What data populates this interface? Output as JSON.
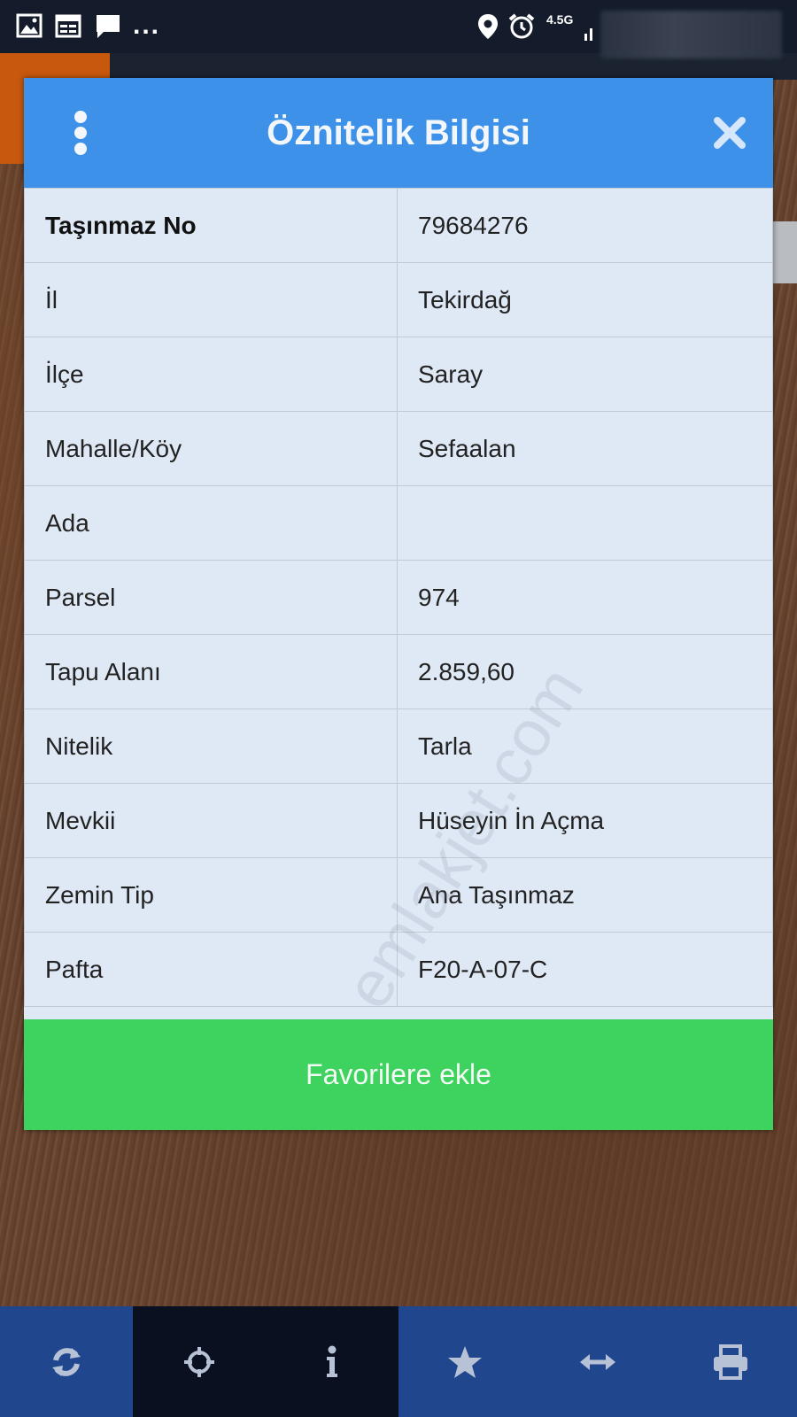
{
  "status_bar": {
    "overflow_dots": "...",
    "network_label": "4.5G",
    "icons": [
      "image-icon",
      "calendar-icon",
      "message-icon",
      "location-icon",
      "alarm-icon",
      "signal-icon"
    ]
  },
  "dialog": {
    "title": "Öznitelik Bilgisi",
    "rows": [
      {
        "key": "Taşınmaz No",
        "value": "79684276"
      },
      {
        "key": "İl",
        "value": "Tekirdağ"
      },
      {
        "key": "İlçe",
        "value": "Saray"
      },
      {
        "key": "Mahalle/Köy",
        "value": "Sefaalan"
      },
      {
        "key": "Ada",
        "value": ""
      },
      {
        "key": "Parsel",
        "value": "974"
      },
      {
        "key": "Tapu Alanı",
        "value": "2.859,60"
      },
      {
        "key": "Nitelik",
        "value": "Tarla"
      },
      {
        "key": "Mevkii",
        "value": "Hüseyin İn Açma"
      },
      {
        "key": "Zemin Tip",
        "value": "Ana Taşınmaz"
      },
      {
        "key": "Pafta",
        "value": "F20-A-07-C"
      }
    ],
    "favorite_button": "Favorilere ekle"
  },
  "watermark": "emlakjet.com",
  "toolbar": {
    "items": [
      "refresh-icon",
      "locate-icon",
      "info-icon",
      "star-icon",
      "measure-icon",
      "print-icon"
    ]
  },
  "colors": {
    "header": "#3d91e9",
    "favorite": "#3dd35e",
    "toolbar_blue": "#20468e",
    "toolbar_dark": "#0a1020"
  }
}
